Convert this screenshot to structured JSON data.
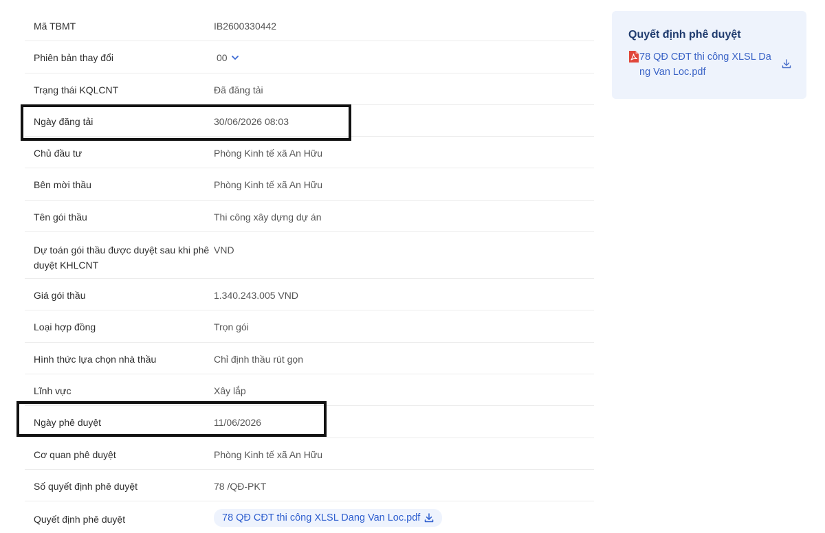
{
  "rows": [
    {
      "label": "Mã TBMT",
      "value": "IB2600330442"
    },
    {
      "label": "Phiên bản thay đổi",
      "value": "00"
    },
    {
      "label": "Trạng thái KQLCNT",
      "value": "Đã đăng tải"
    },
    {
      "label": "Ngày đăng tải",
      "value": "30/06/2026 08:03"
    },
    {
      "label": "Chủ đầu tư",
      "value": "Phòng Kinh tế xã An Hữu"
    },
    {
      "label": "Bên mời thầu",
      "value": "Phòng Kinh tế xã An Hữu"
    },
    {
      "label": "Tên gói thầu",
      "value": "Thi công xây dựng dự án"
    },
    {
      "label": "Dự toán gói thầu được duyệt sau khi phê duyệt KHLCNT",
      "value": "VND"
    },
    {
      "label": "Giá gói thầu",
      "value": "1.340.243.005 VND"
    },
    {
      "label": "Loại hợp đồng",
      "value": "Trọn gói"
    },
    {
      "label": "Hình thức lựa chọn nhà thầu",
      "value": "Chỉ định thầu rút gọn"
    },
    {
      "label": "Lĩnh vực",
      "value": "Xây lắp"
    },
    {
      "label": "Ngày phê duyệt",
      "value": "11/06/2026"
    },
    {
      "label": "Cơ quan phê duyệt",
      "value": "Phòng Kinh tế xã An Hữu"
    },
    {
      "label": "Số quyết định phê duyệt",
      "value": "78 /QĐ-PKT"
    },
    {
      "label": "Quyết định phê duyệt",
      "value": "78 QĐ CĐT thi công XLSL Dang Van Loc.pdf"
    }
  ],
  "side": {
    "title": "Quyết định phê duyệt",
    "file_name": "78 QĐ CĐT thi công XLSL Dang Van Loc.pdf"
  },
  "icons": {
    "version_dropdown": "chevron-down-icon",
    "download": "download-icon",
    "pdf": "pdf-file-icon"
  },
  "colors": {
    "link": "#3a63c6",
    "chip_bg": "#eef3fd",
    "card_bg": "#eef3fc",
    "pdf_red": "#e0463a",
    "highlight_border": "#111111"
  }
}
